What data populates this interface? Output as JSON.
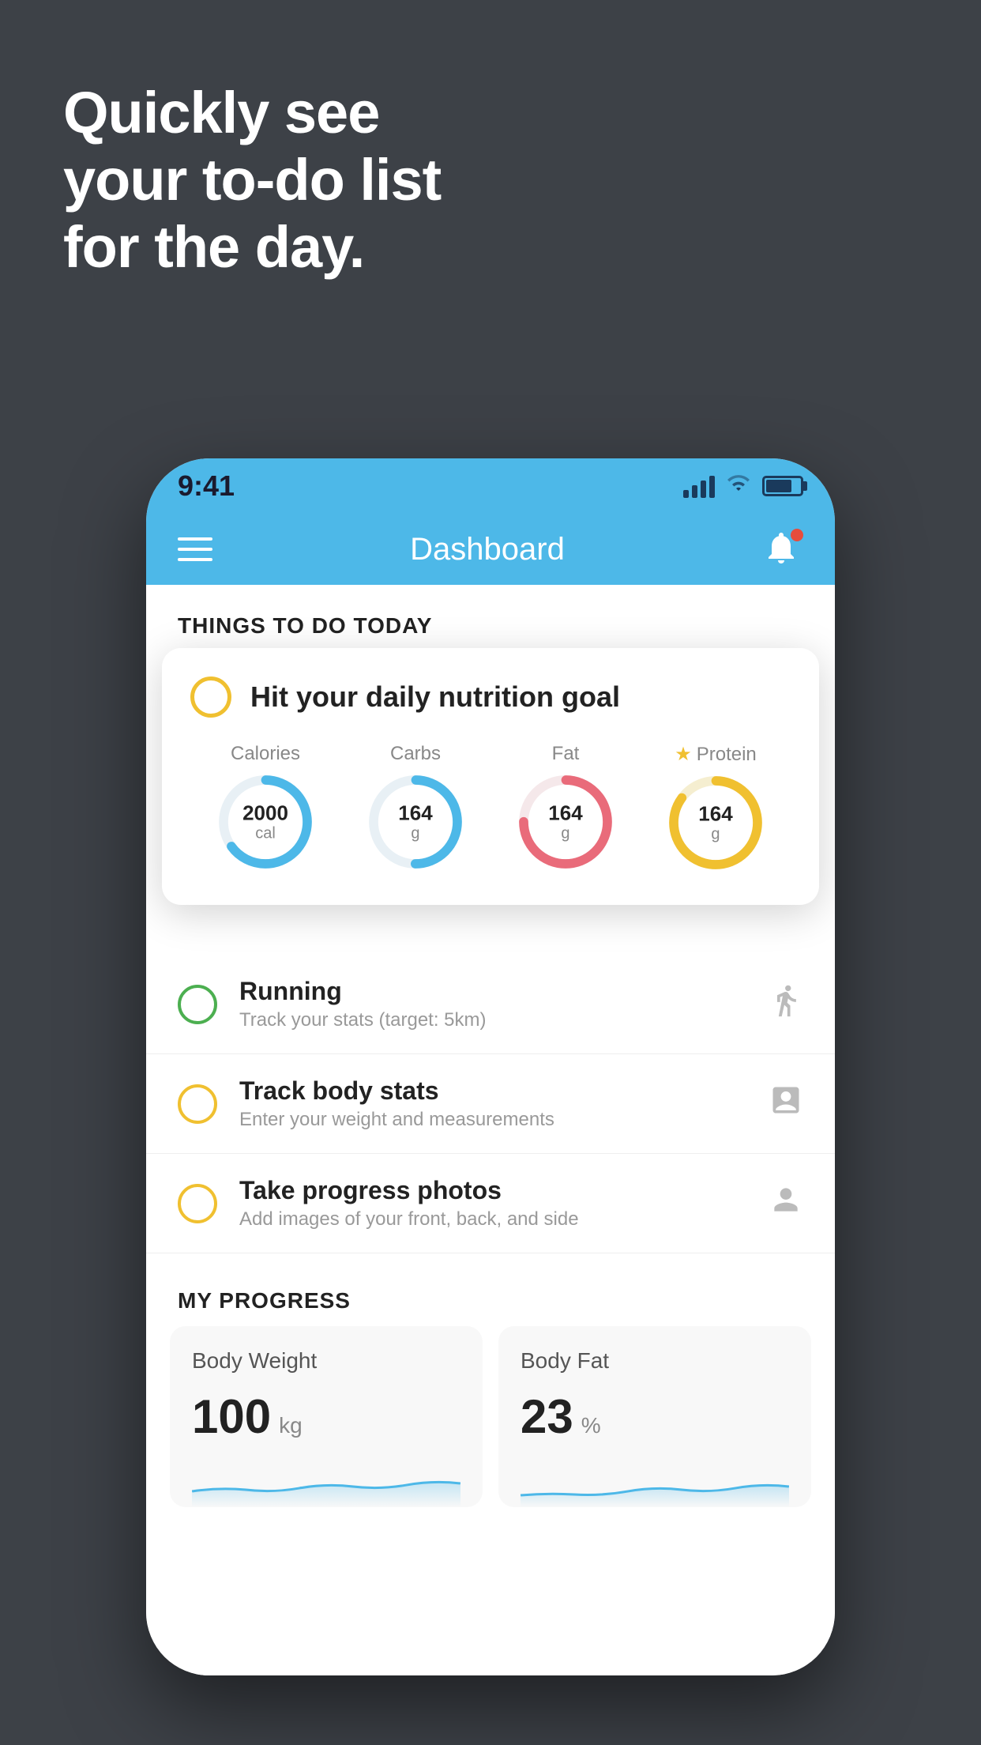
{
  "background_color": "#3d4147",
  "hero": {
    "line1": "Quickly see",
    "line2": "your to-do list",
    "line3": "for the day."
  },
  "phone": {
    "status_bar": {
      "time": "9:41",
      "signal_bars": 4,
      "wifi": true,
      "battery": 75
    },
    "nav_bar": {
      "title": "Dashboard",
      "has_notification": true
    },
    "section_header": "THINGS TO DO TODAY",
    "floating_card": {
      "title": "Hit your daily nutrition goal",
      "nutrition": [
        {
          "label": "Calories",
          "value": "2000",
          "unit": "cal",
          "color": "#4db8e8",
          "star": false,
          "pct": 65
        },
        {
          "label": "Carbs",
          "value": "164",
          "unit": "g",
          "color": "#4db8e8",
          "star": false,
          "pct": 50
        },
        {
          "label": "Fat",
          "value": "164",
          "unit": "g",
          "color": "#e96b7a",
          "star": false,
          "pct": 75
        },
        {
          "label": "Protein",
          "value": "164",
          "unit": "g",
          "color": "#f0c030",
          "star": true,
          "pct": 85
        }
      ]
    },
    "todo_items": [
      {
        "id": "running",
        "title": "Running",
        "subtitle": "Track your stats (target: 5km)",
        "circle_color": "green",
        "icon": "👟"
      },
      {
        "id": "body-stats",
        "title": "Track body stats",
        "subtitle": "Enter your weight and measurements",
        "circle_color": "yellow",
        "icon": "⚖"
      },
      {
        "id": "photos",
        "title": "Take progress photos",
        "subtitle": "Add images of your front, back, and side",
        "circle_color": "yellow",
        "icon": "👤"
      }
    ],
    "progress": {
      "header": "MY PROGRESS",
      "cards": [
        {
          "id": "body-weight",
          "title": "Body Weight",
          "value": "100",
          "unit": "kg"
        },
        {
          "id": "body-fat",
          "title": "Body Fat",
          "value": "23",
          "unit": "%"
        }
      ]
    }
  }
}
